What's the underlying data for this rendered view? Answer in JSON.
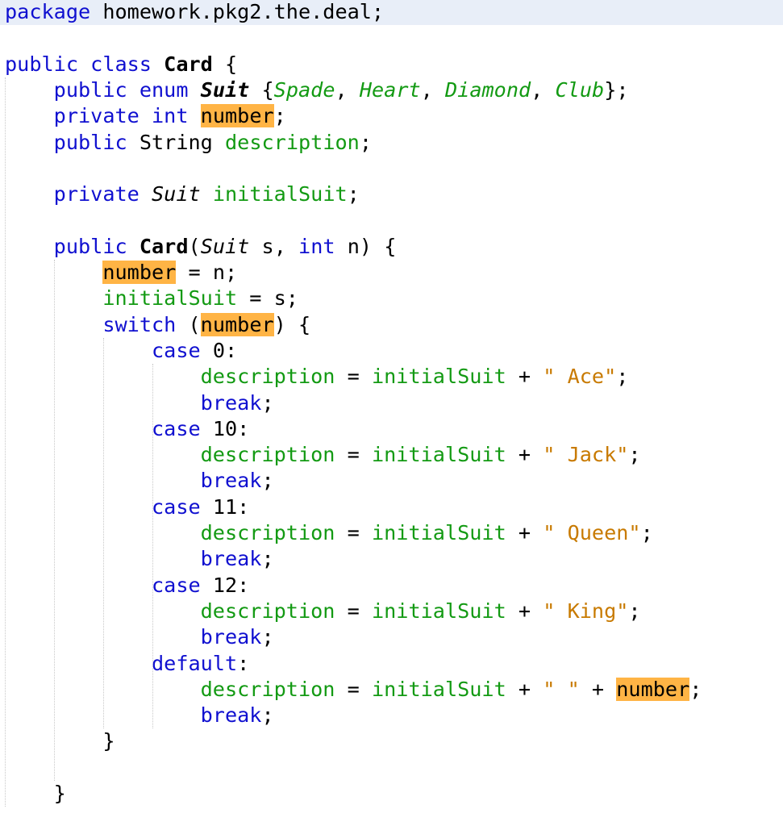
{
  "editor": {
    "language": "java",
    "current_line": 1,
    "highlighted_symbol": "number",
    "colors": {
      "keyword": "#1010d0",
      "field": "#139a13",
      "string": "#c87a00",
      "occurrence_highlight": "#ffb445",
      "current_line": "#e8eef8"
    },
    "lines": [
      {
        "n": 1,
        "indent": 0,
        "tokens": [
          {
            "t": "package",
            "c": "kw"
          },
          {
            "t": " homework.pkg2.the.deal;"
          }
        ]
      },
      {
        "n": 2,
        "indent": 0,
        "tokens": []
      },
      {
        "n": 3,
        "indent": 0,
        "tokens": [
          {
            "t": "public class",
            "c": "kw"
          },
          {
            "t": " "
          },
          {
            "t": "Card",
            "c": "bold"
          },
          {
            "t": " {"
          }
        ]
      },
      {
        "n": 4,
        "indent": 1,
        "tokens": [
          {
            "t": "public enum",
            "c": "kw"
          },
          {
            "t": " "
          },
          {
            "t": "Suit",
            "c": "typb"
          },
          {
            "t": " {"
          },
          {
            "t": "Spade",
            "c": "enumc"
          },
          {
            "t": ", "
          },
          {
            "t": "Heart",
            "c": "enumc"
          },
          {
            "t": ", "
          },
          {
            "t": "Diamond",
            "c": "enumc"
          },
          {
            "t": ", "
          },
          {
            "t": "Club",
            "c": "enumc"
          },
          {
            "t": "};"
          }
        ]
      },
      {
        "n": 5,
        "indent": 1,
        "tokens": [
          {
            "t": "private int",
            "c": "kw"
          },
          {
            "t": " "
          },
          {
            "t": "number",
            "c": "occ"
          },
          {
            "t": ";"
          }
        ]
      },
      {
        "n": 6,
        "indent": 1,
        "tokens": [
          {
            "t": "public",
            "c": "kw"
          },
          {
            "t": " String "
          },
          {
            "t": "description",
            "c": "fld"
          },
          {
            "t": ";"
          }
        ]
      },
      {
        "n": 7,
        "indent": 0,
        "tokens": []
      },
      {
        "n": 8,
        "indent": 1,
        "tokens": [
          {
            "t": "private",
            "c": "kw"
          },
          {
            "t": " "
          },
          {
            "t": "Suit",
            "c": "typ"
          },
          {
            "t": " "
          },
          {
            "t": "initialSuit",
            "c": "fld"
          },
          {
            "t": ";"
          }
        ]
      },
      {
        "n": 9,
        "indent": 0,
        "tokens": []
      },
      {
        "n": 10,
        "indent": 1,
        "tokens": [
          {
            "t": "public",
            "c": "kw"
          },
          {
            "t": " "
          },
          {
            "t": "Card",
            "c": "bold"
          },
          {
            "t": "("
          },
          {
            "t": "Suit",
            "c": "typ"
          },
          {
            "t": " s, "
          },
          {
            "t": "int",
            "c": "kw"
          },
          {
            "t": " n) {"
          }
        ]
      },
      {
        "n": 11,
        "indent": 2,
        "tokens": [
          {
            "t": "number",
            "c": "occ"
          },
          {
            "t": " = n;"
          }
        ]
      },
      {
        "n": 12,
        "indent": 2,
        "tokens": [
          {
            "t": "initialSuit",
            "c": "fld"
          },
          {
            "t": " = s;"
          }
        ]
      },
      {
        "n": 13,
        "indent": 2,
        "tokens": [
          {
            "t": "switch",
            "c": "kw"
          },
          {
            "t": " ("
          },
          {
            "t": "number",
            "c": "occ"
          },
          {
            "t": ") {"
          }
        ]
      },
      {
        "n": 14,
        "indent": 3,
        "tokens": [
          {
            "t": "case",
            "c": "kw"
          },
          {
            "t": " 0:"
          }
        ]
      },
      {
        "n": 15,
        "indent": 4,
        "tokens": [
          {
            "t": "description",
            "c": "fld"
          },
          {
            "t": " = "
          },
          {
            "t": "initialSuit",
            "c": "fld"
          },
          {
            "t": " + "
          },
          {
            "t": "\" Ace\"",
            "c": "str"
          },
          {
            "t": ";"
          }
        ]
      },
      {
        "n": 16,
        "indent": 4,
        "tokens": [
          {
            "t": "break",
            "c": "kw"
          },
          {
            "t": ";"
          }
        ]
      },
      {
        "n": 17,
        "indent": 3,
        "tokens": [
          {
            "t": "case",
            "c": "kw"
          },
          {
            "t": " 10:"
          }
        ]
      },
      {
        "n": 18,
        "indent": 4,
        "tokens": [
          {
            "t": "description",
            "c": "fld"
          },
          {
            "t": " = "
          },
          {
            "t": "initialSuit",
            "c": "fld"
          },
          {
            "t": " + "
          },
          {
            "t": "\" Jack\"",
            "c": "str"
          },
          {
            "t": ";"
          }
        ]
      },
      {
        "n": 19,
        "indent": 4,
        "tokens": [
          {
            "t": "break",
            "c": "kw"
          },
          {
            "t": ";"
          }
        ]
      },
      {
        "n": 20,
        "indent": 3,
        "tokens": [
          {
            "t": "case",
            "c": "kw"
          },
          {
            "t": " 11:"
          }
        ]
      },
      {
        "n": 21,
        "indent": 4,
        "tokens": [
          {
            "t": "description",
            "c": "fld"
          },
          {
            "t": " = "
          },
          {
            "t": "initialSuit",
            "c": "fld"
          },
          {
            "t": " + "
          },
          {
            "t": "\" Queen\"",
            "c": "str"
          },
          {
            "t": ";"
          }
        ]
      },
      {
        "n": 22,
        "indent": 4,
        "tokens": [
          {
            "t": "break",
            "c": "kw"
          },
          {
            "t": ";"
          }
        ]
      },
      {
        "n": 23,
        "indent": 3,
        "tokens": [
          {
            "t": "case",
            "c": "kw"
          },
          {
            "t": " 12:"
          }
        ]
      },
      {
        "n": 24,
        "indent": 4,
        "tokens": [
          {
            "t": "description",
            "c": "fld"
          },
          {
            "t": " = "
          },
          {
            "t": "initialSuit",
            "c": "fld"
          },
          {
            "t": " + "
          },
          {
            "t": "\" King\"",
            "c": "str"
          },
          {
            "t": ";"
          }
        ]
      },
      {
        "n": 25,
        "indent": 4,
        "tokens": [
          {
            "t": "break",
            "c": "kw"
          },
          {
            "t": ";"
          }
        ]
      },
      {
        "n": 26,
        "indent": 3,
        "tokens": [
          {
            "t": "default",
            "c": "kw"
          },
          {
            "t": ":"
          }
        ]
      },
      {
        "n": 27,
        "indent": 4,
        "tokens": [
          {
            "t": "description",
            "c": "fld"
          },
          {
            "t": " = "
          },
          {
            "t": "initialSuit",
            "c": "fld"
          },
          {
            "t": " + "
          },
          {
            "t": "\" \"",
            "c": "str"
          },
          {
            "t": " + "
          },
          {
            "t": "number",
            "c": "occ"
          },
          {
            "t": ";"
          }
        ]
      },
      {
        "n": 28,
        "indent": 4,
        "tokens": [
          {
            "t": "break",
            "c": "kw"
          },
          {
            "t": ";"
          }
        ]
      },
      {
        "n": 29,
        "indent": 2,
        "tokens": [
          {
            "t": "}"
          }
        ]
      },
      {
        "n": 30,
        "indent": 0,
        "tokens": []
      },
      {
        "n": 31,
        "indent": 1,
        "tokens": [
          {
            "t": "}"
          }
        ]
      }
    ]
  }
}
